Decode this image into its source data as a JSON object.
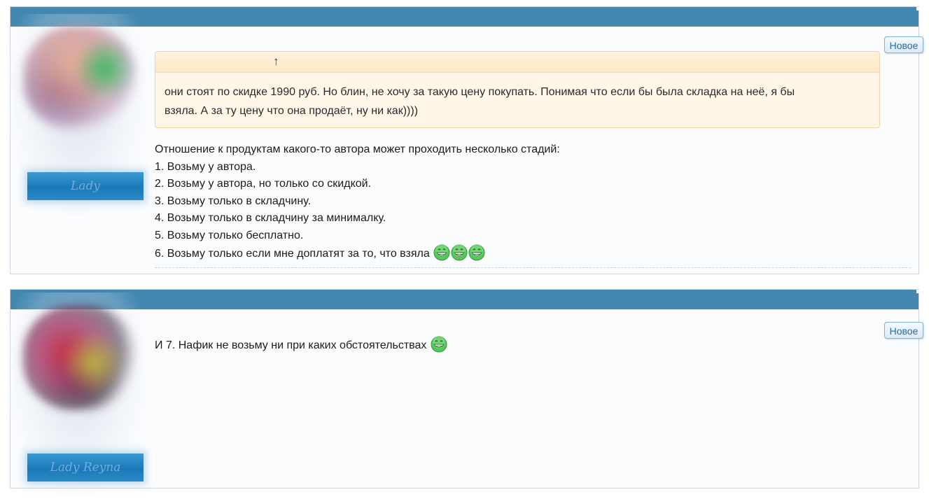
{
  "posts": [
    {
      "new_label": "Новое",
      "avatar_badge": "Lady",
      "quote": {
        "arrow": "↑",
        "lines": [
          "они стоят по скидке 1990 руб. Но блин, не хочу за такую цену покупать. Понимая что если бы была складка на неё, я бы",
          "взяла. А за ту цену что она продаёт, ну ни как))))"
        ]
      },
      "message_lines": [
        "Отношение к продуктам какого-то автора может проходить несколько стадий:",
        "1. Возьму у автора.",
        "2. Возьму у автора, но только со скидкой.",
        "3. Возьму только в складчину.",
        "4. Возьму только в складчину за минималку.",
        "5. Возьму только бесплатно.",
        "6. Возьму только если мне доплатят за то, что взяла"
      ],
      "smileys": [
        "grin-icon",
        "grin-icon",
        "grin-icon"
      ]
    },
    {
      "new_label": "Новое",
      "avatar_badge": "Lady Reyna",
      "message_lines": [
        "И 7. Нафик не возьму ни при каких обстоятельствах"
      ],
      "smileys": [
        "grin-icon"
      ]
    }
  ],
  "colors": {
    "header": "#4387b0",
    "quote_bg": "#fff6e8",
    "quote_border": "#f0d3a3",
    "tag_text": "#2c6a9c",
    "smiley": "#3fbf4a"
  }
}
